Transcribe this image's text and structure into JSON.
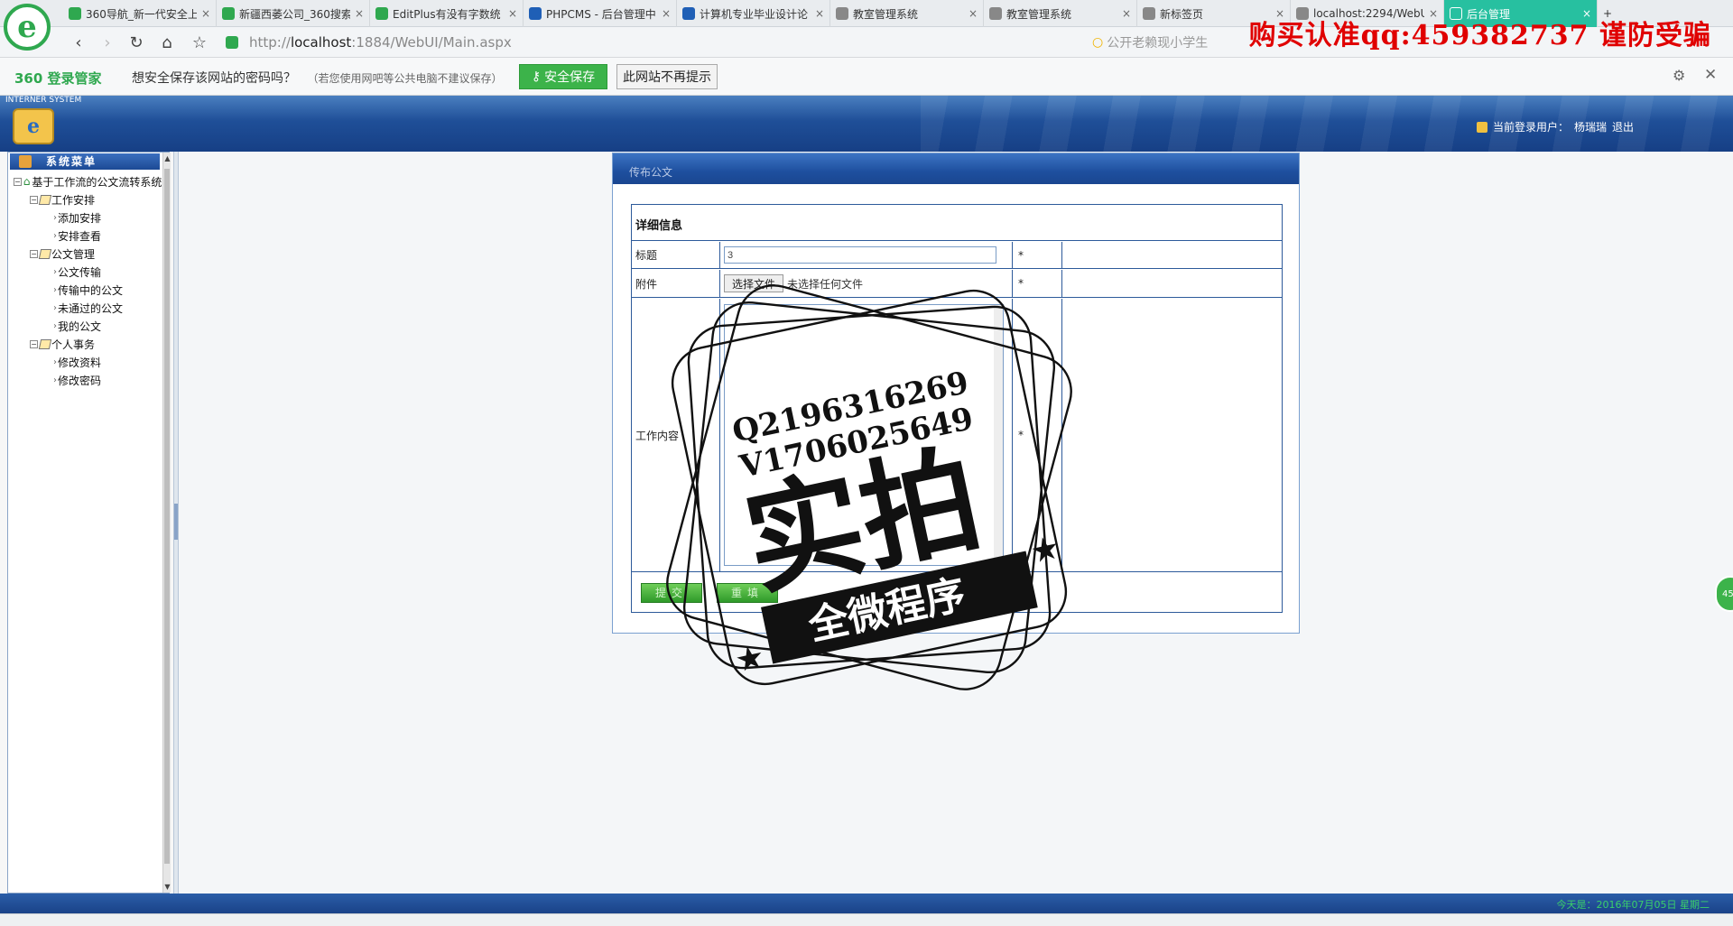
{
  "browser": {
    "tabs": [
      {
        "label": "360导航_新一代安全上",
        "color": "#2fa84f",
        "active": false
      },
      {
        "label": "新疆西萎公司_360搜索",
        "color": "#2fa84f",
        "active": false
      },
      {
        "label": "EditPlus有没有字数统",
        "color": "#2fa84f",
        "active": false
      },
      {
        "label": "PHPCMS - 后台管理中",
        "color": "#1f5fb6",
        "active": false
      },
      {
        "label": "计算机专业毕业设计论",
        "color": "#1f5fb6",
        "active": false
      },
      {
        "label": "教室管理系统",
        "color": "#888888",
        "active": false
      },
      {
        "label": "教室管理系统",
        "color": "#888888",
        "active": false
      },
      {
        "label": "新标签页",
        "color": "#888888",
        "active": false
      },
      {
        "label": "localhost:2294/WebU",
        "color": "#888888",
        "active": false
      },
      {
        "label": "后台管理",
        "color": "#ffffff",
        "active": true
      }
    ],
    "tab_close": "×",
    "new_tab": "+",
    "url_prefix": "http://",
    "url_host": "localhost",
    "url_rest": ":1884/WebUI/Main.aspx",
    "search_placeholder": "公开老赖现小学生",
    "watermark_top": "购买认准qq:459382737 谨防受骗",
    "logo_letter": "e"
  },
  "password_bar": {
    "brand": "360 登录管家",
    "question": "想安全保存该网站的密码吗？",
    "note": "（若您使用网吧等公共电脑不建议保存）",
    "save_label": "安全保存",
    "never_label": "此网站不再提示"
  },
  "app": {
    "system_label": "INTERNER SYSTEM",
    "user_label": "当前登录用户：",
    "user_name": "杨瑞瑞",
    "logout": "退出"
  },
  "sidebar": {
    "title": "系统菜单",
    "root": "基于工作流的公文流转系统",
    "groups": [
      {
        "label": "工作安排",
        "items": [
          "添加安排",
          "安排查看"
        ]
      },
      {
        "label": "公文管理",
        "items": [
          "公文传输",
          "传输中的公文",
          "未通过的公文",
          "我的公文"
        ]
      },
      {
        "label": "个人事务",
        "items": [
          "修改资料",
          "修改密码"
        ]
      }
    ]
  },
  "form": {
    "panel_title": "传布公文",
    "section_title": "详细信息",
    "title_label": "标题",
    "title_value": "3",
    "attachment_label": "附件",
    "file_button": "选择文件",
    "file_status": "未选择任何文件",
    "content_label": "工作内容",
    "required_mark": "*",
    "submit_label": "提交",
    "reset_label": "重填"
  },
  "watermark_stamp": {
    "line1": "Q2196316269",
    "line2": "V1706025649",
    "main": "实拍",
    "ribbon": "全微程序"
  },
  "status": {
    "text": "今天是：2016年07月05日 星期二"
  }
}
